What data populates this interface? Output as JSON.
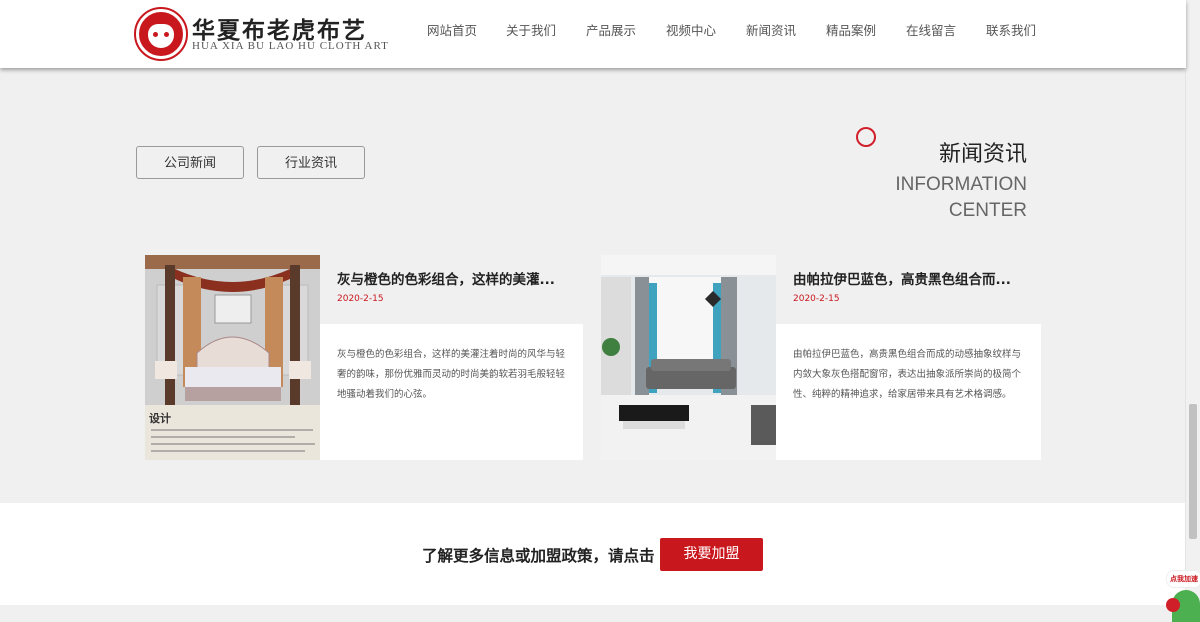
{
  "header": {
    "logo_title": "华夏布老虎布艺",
    "logo_subtitle": "HUA XIA BU LAO HU CLOTH ART",
    "nav": [
      "网站首页",
      "关于我们",
      "产品展示",
      "视频中心",
      "新闻资讯",
      "精品案例",
      "在线留言",
      "联系我们"
    ]
  },
  "news": {
    "tabs": [
      "公司新闻",
      "行业资讯"
    ],
    "title_cn": "新闻资讯",
    "title_en_line1": "INFORMATION",
    "title_en_line2": "CENTER",
    "items": [
      {
        "title": "灰与橙色的色彩组合，这样的美灌...",
        "date": "2020-2-15",
        "desc": "灰与橙色的色彩组合，这样的美灌注着时尚的风华与轻奢的韵味，那份优雅而灵动的时尚美韵软若羽毛般轻轻地骚动着我们的心弦。",
        "image_text": "设计"
      },
      {
        "title": "由帕拉伊巴蓝色，高贵黑色组合而...",
        "date": "2020-2-15",
        "desc": "由帕拉伊巴蓝色，高贵黑色组合而成的动感抽象纹样与内敛大象灰色搭配窗帘，表达出抽象派所崇尚的极简个性、纯粹的精神追求，给家居带来具有艺术格调感。"
      }
    ]
  },
  "join": {
    "text": "了解更多信息或加盟政策，请点击",
    "button": "我要加盟"
  },
  "float_widget": {
    "label": "点我加速"
  },
  "colors": {
    "accent": "#c9171e",
    "bg": "#f0f0f0"
  }
}
